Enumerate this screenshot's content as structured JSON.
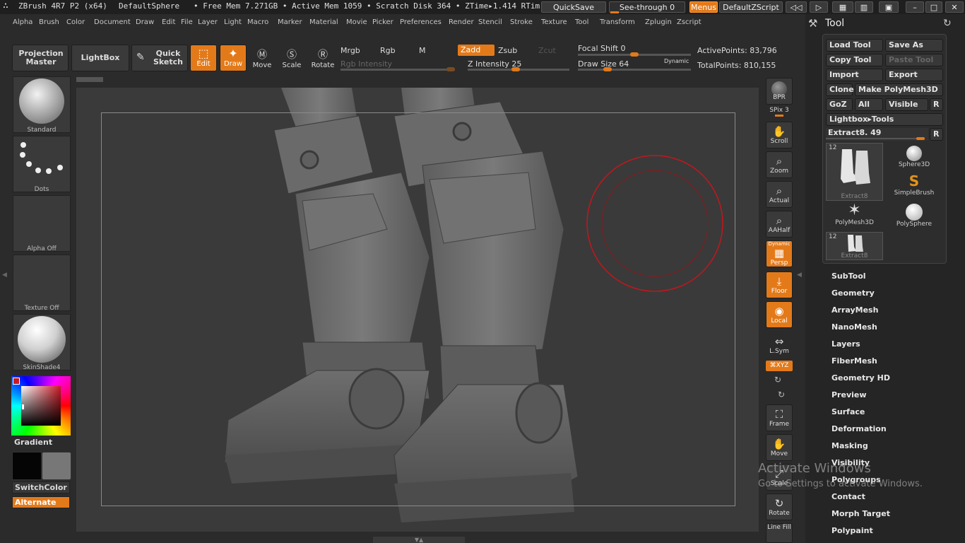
{
  "titlebar": {
    "app": "ZBrush 4R7 P2 (x64)",
    "document": "DefaultSphere",
    "mem": "• Free Mem 7.271GB • Active Mem 1059 • Scratch Disk 364 • ZTime▸1.414 RTim",
    "quicksave": "QuickSave",
    "seethrough": "See-through  0",
    "menus": "Menus",
    "zscript": "DefaultZScript"
  },
  "menubar": [
    "Alpha",
    "Brush",
    "Color",
    "Document",
    "Draw",
    "Edit",
    "File",
    "Layer",
    "Light",
    "Macro",
    "Marker",
    "Material",
    "Movie",
    "Picker",
    "Preferences",
    "Render",
    "Stencil",
    "Stroke",
    "Texture",
    "Tool",
    "Transform",
    "Zplugin",
    "Zscript"
  ],
  "toolbar": {
    "projection_master": "Projection Master",
    "lightbox": "LightBox",
    "quick_sketch": "Quick Sketch",
    "edit": "Edit",
    "draw": "Draw",
    "move": "Move",
    "scale": "Scale",
    "rotate": "Rotate",
    "mrgb": "Mrgb",
    "rgb": "Rgb",
    "m": "M",
    "zadd": "Zadd",
    "zsub": "Zsub",
    "zcut": "Zcut",
    "rgb_intensity": "Rgb Intensity",
    "z_intensity": "Z Intensity 25",
    "focal_shift": "Focal Shift 0",
    "draw_size": "Draw Size 64",
    "dynamic": "Dynamic",
    "active_points": "ActivePoints: 83,796",
    "total_points": "TotalPoints: 810,155"
  },
  "leftshelf": {
    "brush": "Standard",
    "stroke": "Dots",
    "alpha": "Alpha  Off",
    "texture": "Texture  Off",
    "material": "SkinShade4",
    "gradient": "Gradient",
    "switchcolor": "SwitchColor",
    "alternate": "Alternate"
  },
  "rightshelf": {
    "bpr": "BPR",
    "spix": "SPix 3",
    "scroll": "Scroll",
    "zoom": "Zoom",
    "actual": "Actual",
    "aahalf": "AAHalf",
    "dynamic": "Dynamic",
    "persp": "Persp",
    "floor": "Floor",
    "local": "Local",
    "lsym": "L.Sym",
    "xyz": "⌘XYZ",
    "frame": "Frame",
    "move": "Move",
    "scale": "Scale",
    "rotate": "Rotate",
    "linefill": "Line Fill"
  },
  "toolpanel": {
    "title": "Tool",
    "load_tool": "Load Tool",
    "save_as": "Save As",
    "copy_tool": "Copy Tool",
    "paste_tool": "Paste Tool",
    "import": "Import",
    "export": "Export",
    "clone": "Clone",
    "make_polymesh": "Make PolyMesh3D",
    "goz": "GoZ",
    "all": "All",
    "visible": "Visible",
    "r": "R",
    "lightbox_tools": "Lightbox▸Tools",
    "extract_slider": "Extract8. 49",
    "thumbs": [
      {
        "label": "Extract8",
        "count": "12"
      },
      {
        "label": "Sphere3D",
        "count": ""
      },
      {
        "label": "SimpleBrush",
        "count": ""
      },
      {
        "label": "PolyMesh3D",
        "count": ""
      },
      {
        "label": "PolySphere",
        "count": ""
      },
      {
        "label": "Extract8",
        "count": "12"
      }
    ],
    "sections": [
      "SubTool",
      "Geometry",
      "ArrayMesh",
      "NanoMesh",
      "Layers",
      "FiberMesh",
      "Geometry HD",
      "Preview",
      "Surface",
      "Deformation",
      "Masking",
      "Visibility",
      "Polygroups",
      "Contact",
      "Morph Target",
      "Polypaint"
    ]
  },
  "watermark": {
    "line1": "Activate Windows",
    "line2": "Go to Settings to activate Windows."
  },
  "colors": {
    "accent": "#e37a1a",
    "brush_ring": "#c4161c"
  }
}
